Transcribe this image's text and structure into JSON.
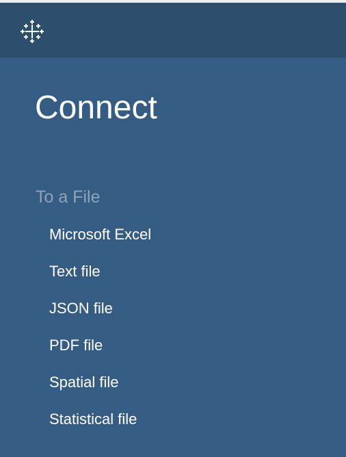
{
  "header": {
    "logo_icon": "tableau-cross-logo-icon"
  },
  "connect": {
    "title": "Connect",
    "section_label": "To a File",
    "items": [
      {
        "label": "Microsoft Excel"
      },
      {
        "label": "Text file"
      },
      {
        "label": "JSON file"
      },
      {
        "label": "PDF file"
      },
      {
        "label": "Spatial file"
      },
      {
        "label": "Statistical file"
      }
    ]
  },
  "colors": {
    "panel_background": "#355d84",
    "header_background": "#2e4e6d",
    "section_label": "#8fa4ba",
    "text": "#ffffff"
  }
}
